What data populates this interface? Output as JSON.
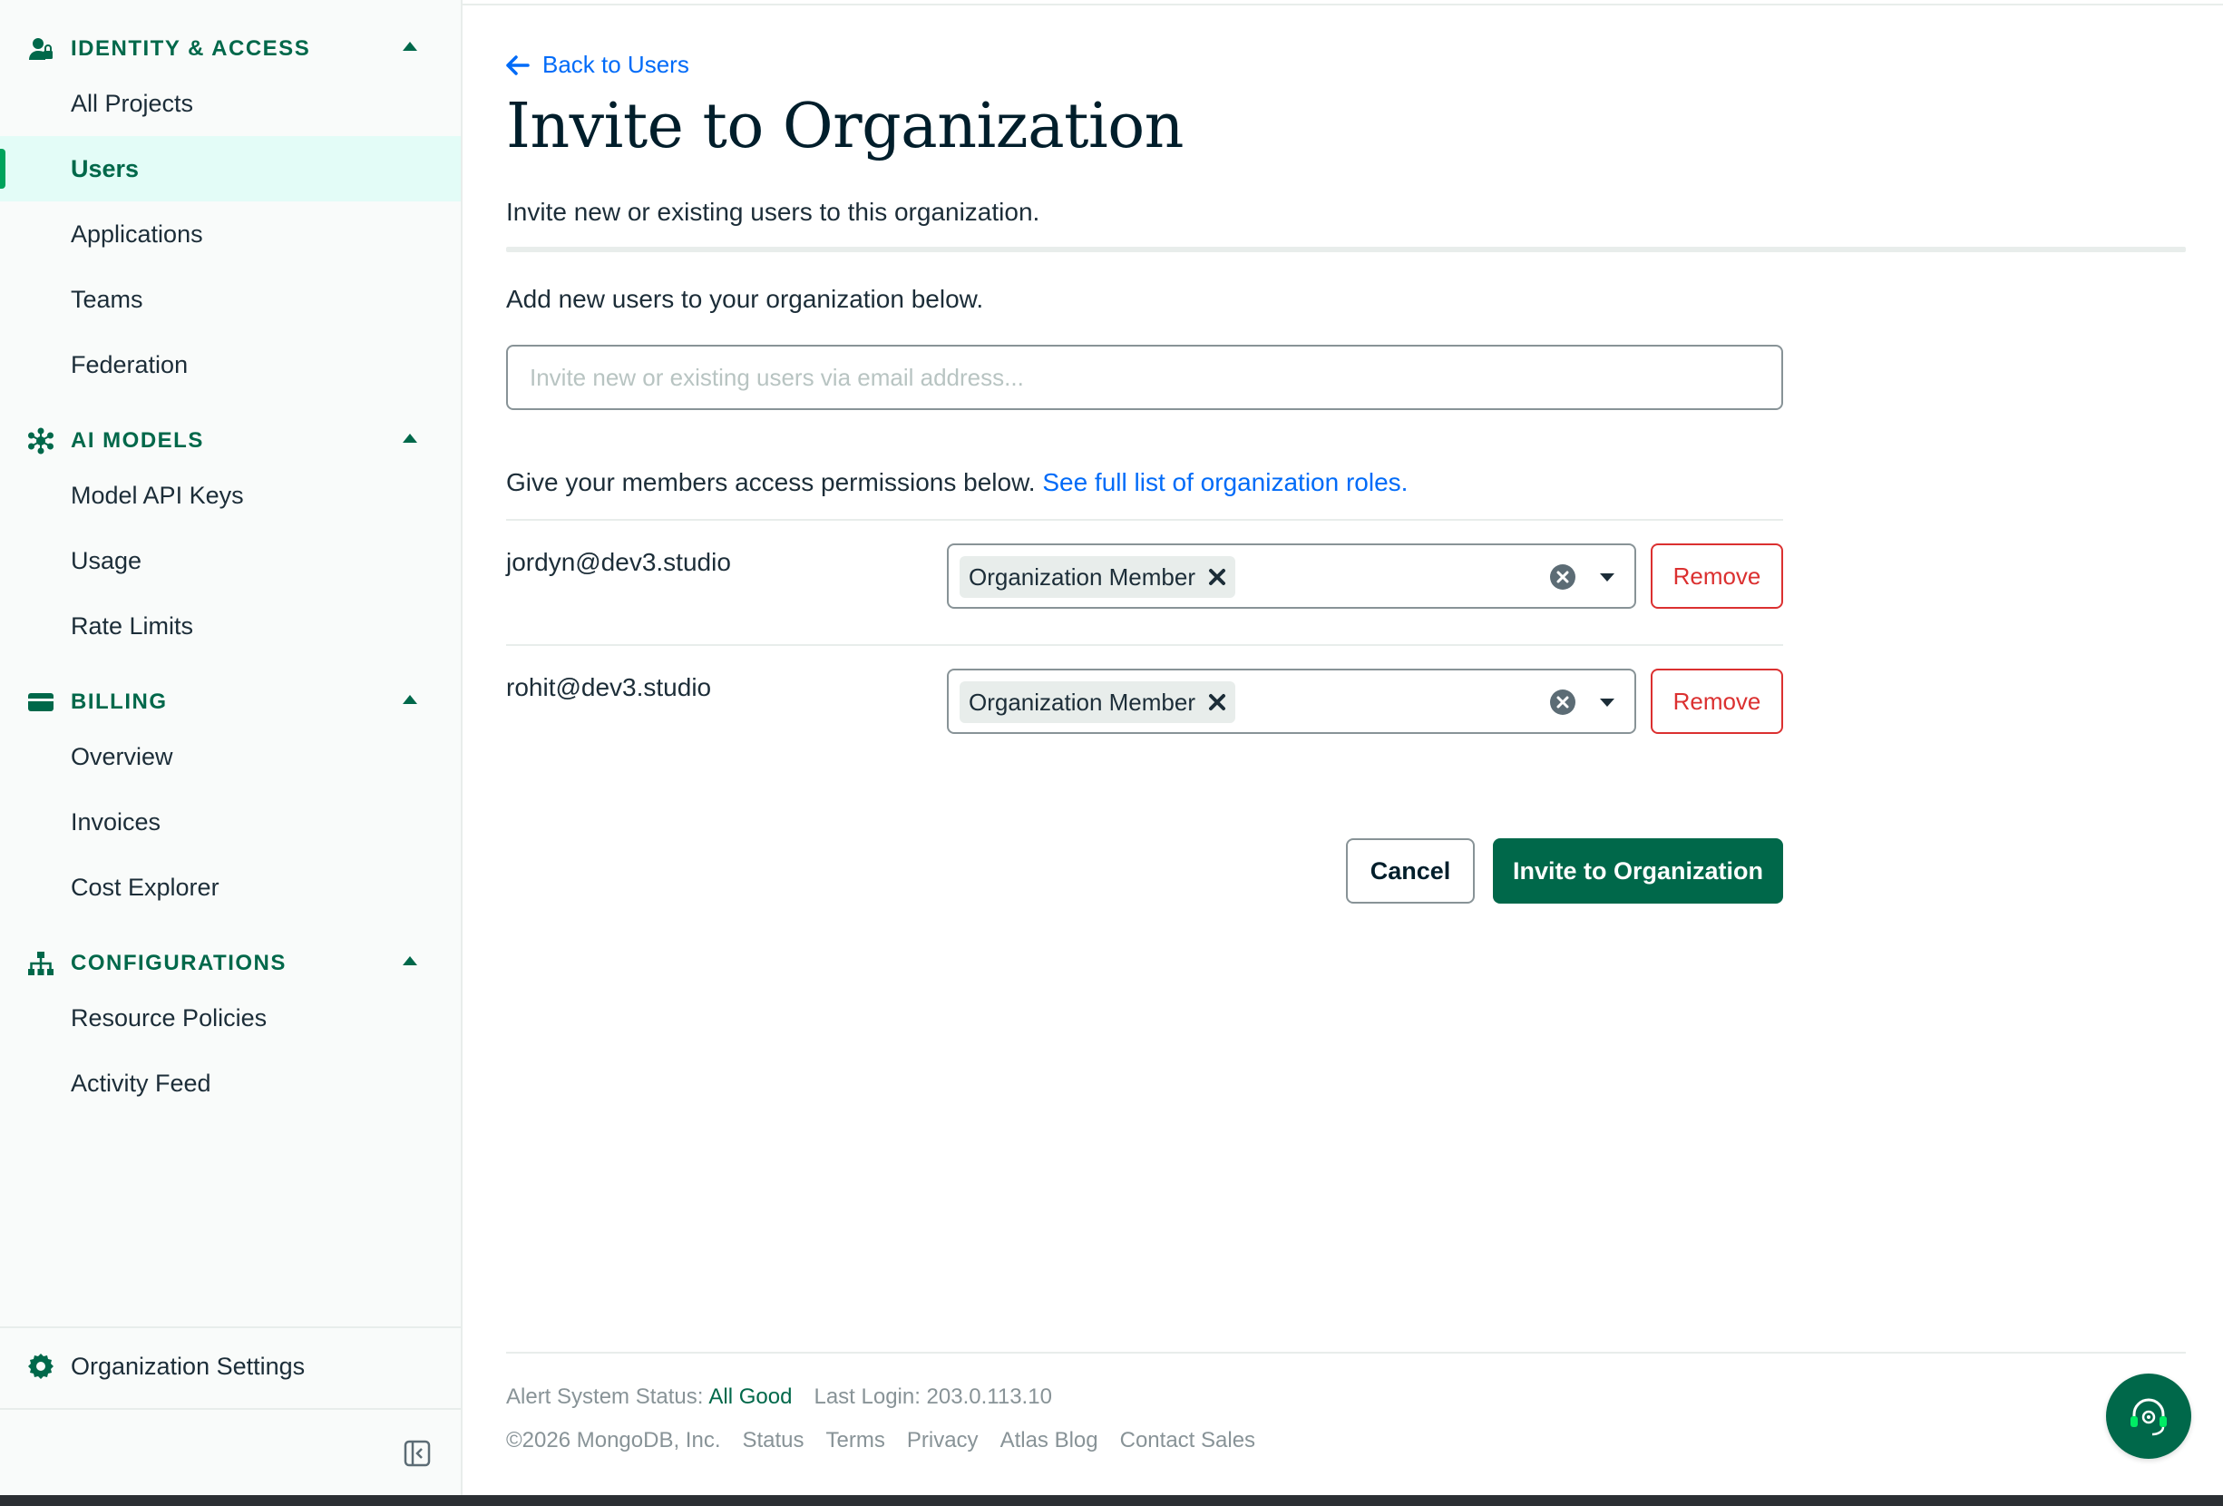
{
  "sidebar": {
    "sections": [
      {
        "label": "IDENTITY & ACCESS",
        "icon": "person-lock-icon",
        "items": [
          "All Projects",
          "Users",
          "Applications",
          "Teams",
          "Federation"
        ]
      },
      {
        "label": "AI MODELS",
        "icon": "ai-model-icon",
        "items": [
          "Model API Keys",
          "Usage",
          "Rate Limits"
        ]
      },
      {
        "label": "BILLING",
        "icon": "credit-card-icon",
        "items": [
          "Overview",
          "Invoices",
          "Cost Explorer"
        ]
      },
      {
        "label": "CONFIGURATIONS",
        "icon": "hierarchy-icon",
        "items": [
          "Resource Policies",
          "Activity Feed"
        ]
      }
    ],
    "active_item": "Users",
    "org_settings_label": "Organization Settings"
  },
  "main": {
    "back_link": "Back to Users",
    "title": "Invite to Organization",
    "subtitle": "Invite new or existing users to this organization.",
    "add_users_text": "Add new users to your organization below.",
    "email_input": {
      "value": "",
      "placeholder": "Invite new or existing users via email address..."
    },
    "permissions_text": "Give your members access permissions below.",
    "roles_link": "See full list of organization roles.",
    "members": [
      {
        "email": "jordyn@dev3.studio",
        "role": "Organization Member",
        "remove_label": "Remove"
      },
      {
        "email": "rohit@dev3.studio",
        "role": "Organization Member",
        "remove_label": "Remove"
      }
    ],
    "cancel_label": "Cancel",
    "invite_label": "Invite to Organization"
  },
  "footer": {
    "status_label": "Alert System Status:",
    "status_value": "All Good",
    "last_login": "Last Login: 203.0.113.10",
    "copyright": "©2026 MongoDB, Inc.",
    "links": [
      "Status",
      "Terms",
      "Privacy",
      "Atlas Blog",
      "Contact Sales"
    ]
  },
  "colors": {
    "brand_green": "#00684a",
    "link_blue": "#016bf8",
    "danger_red": "#db3030",
    "active_bg": "#e3fcf7"
  }
}
